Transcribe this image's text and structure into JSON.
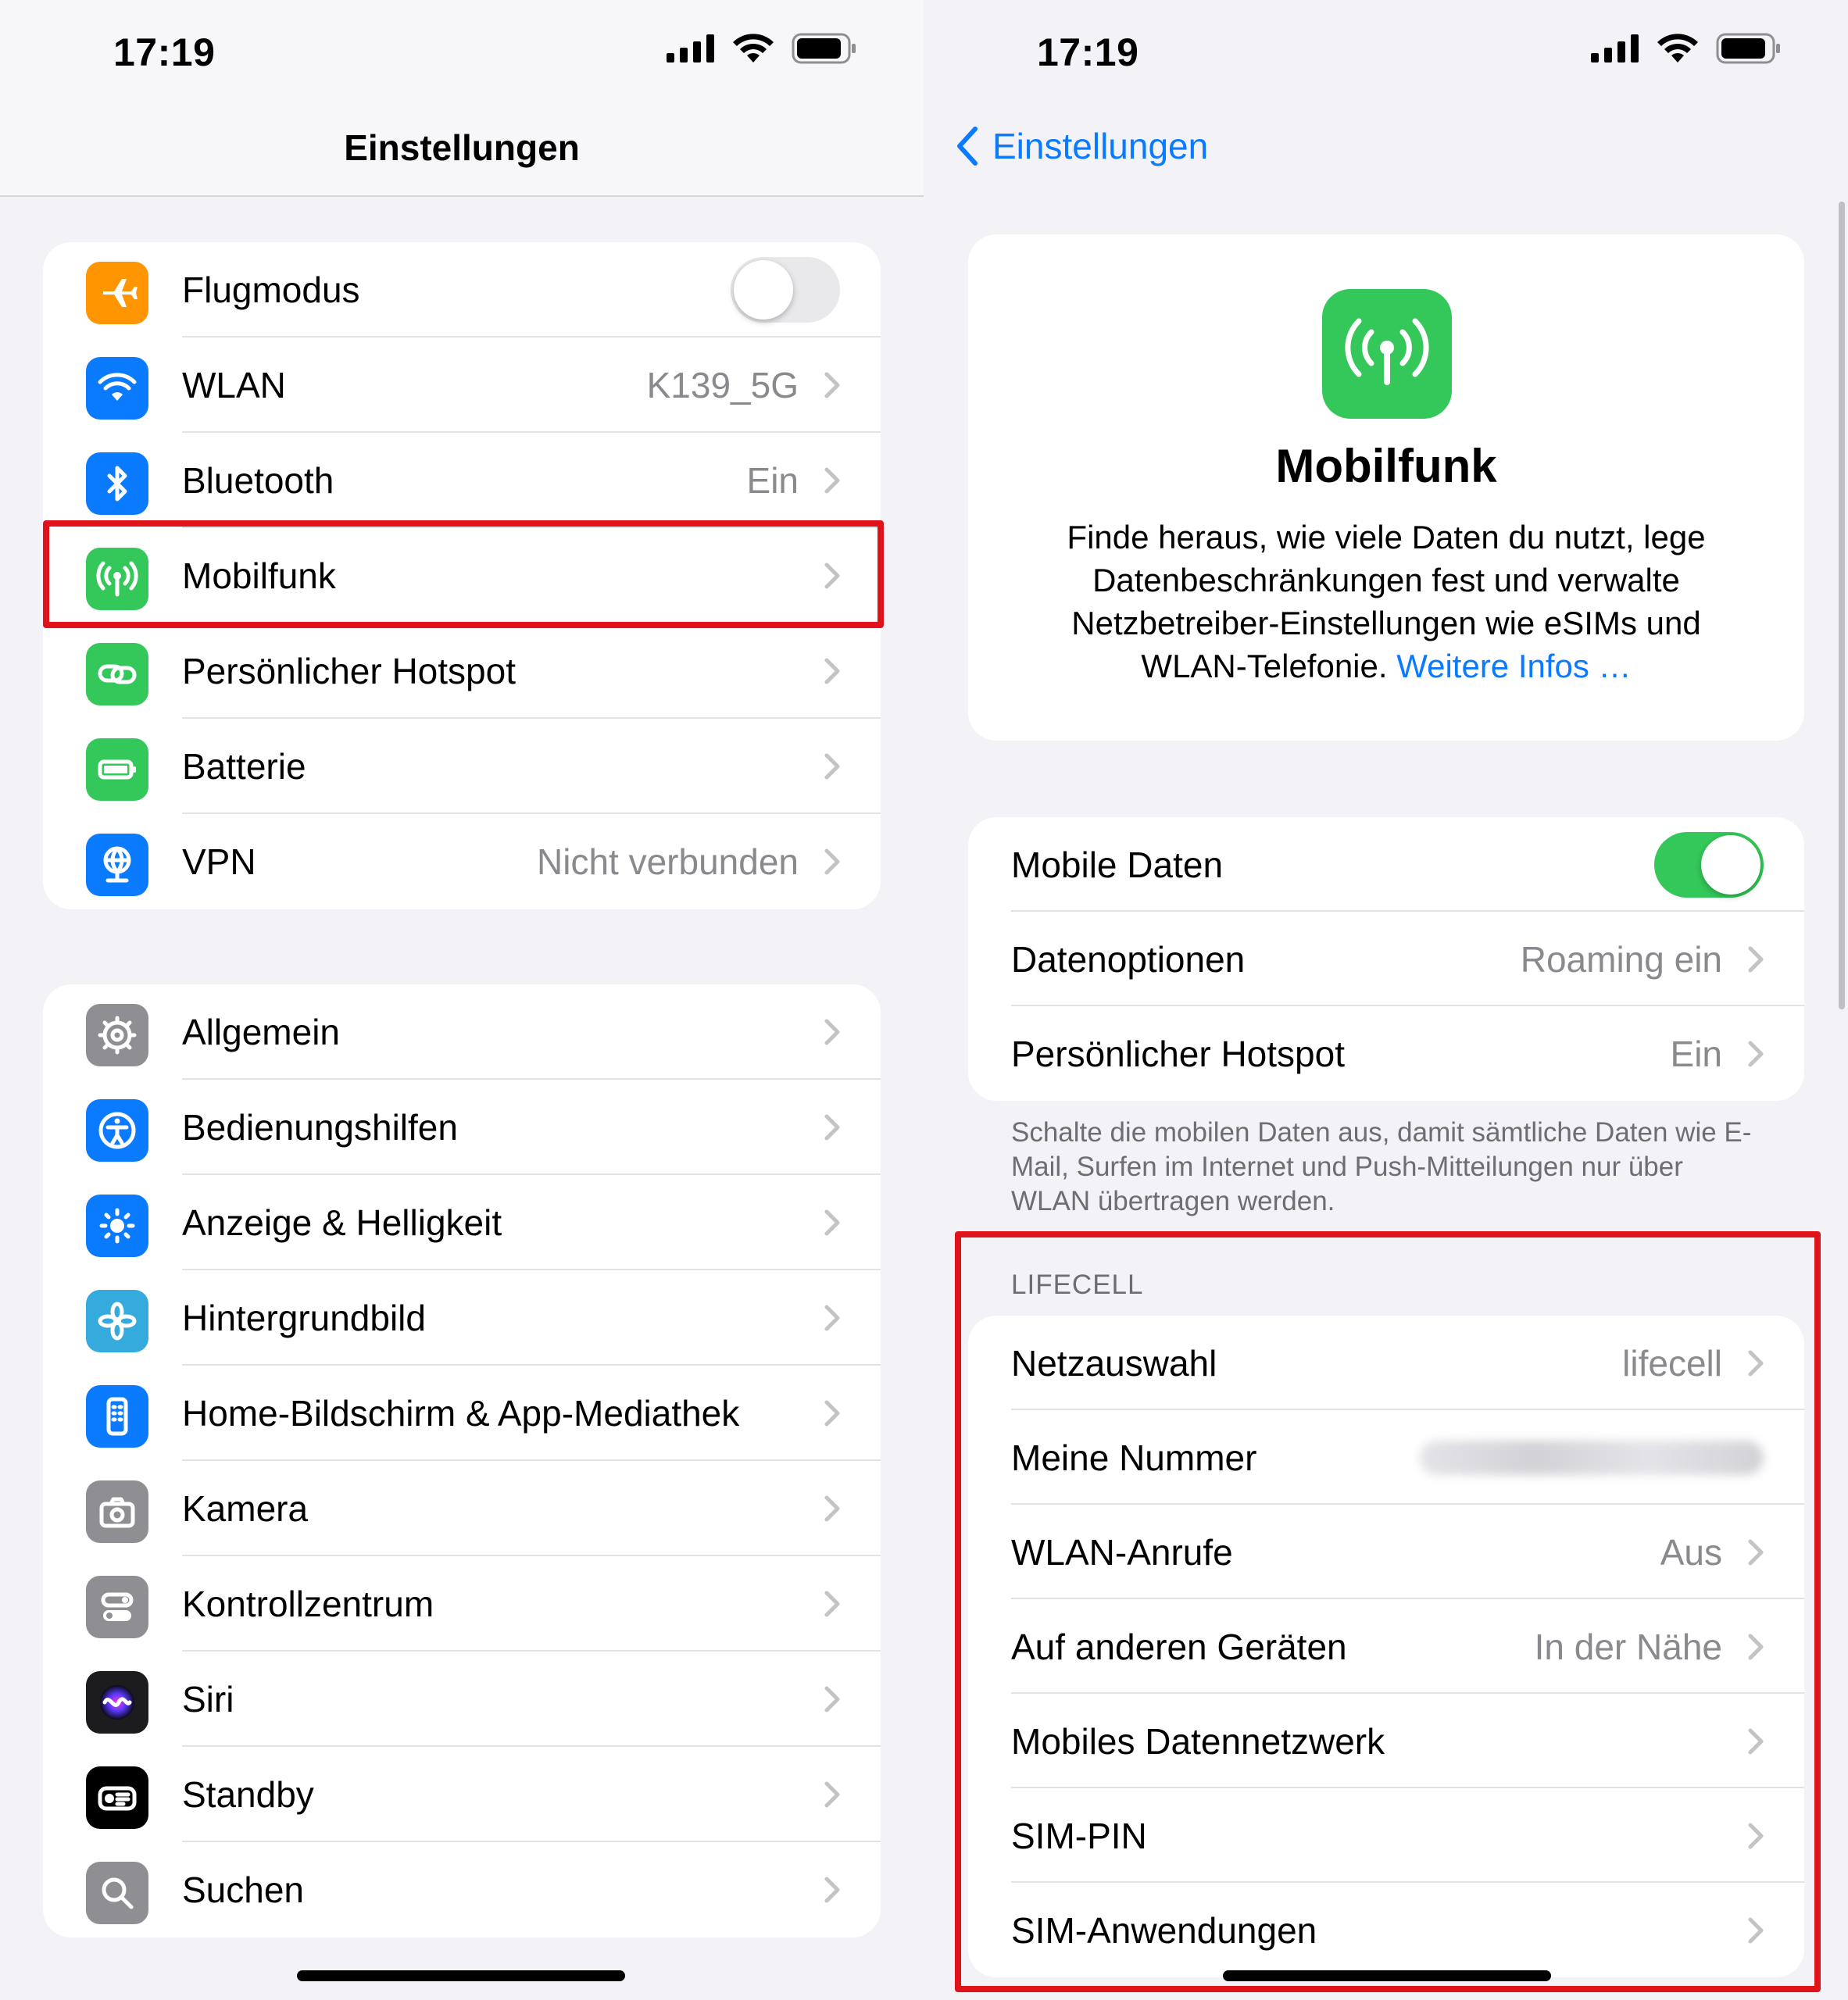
{
  "status": {
    "time": "17:19"
  },
  "left": {
    "nav_title": "Einstellungen",
    "group1": [
      {
        "label": "Flugmodus",
        "icon": "airplane-icon",
        "color": "#ff9500",
        "toggle": false
      },
      {
        "label": "WLAN",
        "icon": "wifi-icon",
        "color": "#0a7aff",
        "value": "K139_5G"
      },
      {
        "label": "Bluetooth",
        "icon": "bluetooth-icon",
        "color": "#0a7aff",
        "value": "Ein"
      },
      {
        "label": "Mobilfunk",
        "icon": "antenna-icon",
        "color": "#34c759",
        "value": ""
      },
      {
        "label": "Persönlicher Hotspot",
        "icon": "hotspot-link-icon",
        "color": "#34c759",
        "value": ""
      },
      {
        "label": "Batterie",
        "icon": "battery-icon",
        "color": "#34c759",
        "value": ""
      },
      {
        "label": "VPN",
        "icon": "vpn-globe-icon",
        "color": "#0a7aff",
        "value": "Nicht verbunden"
      }
    ],
    "group2": [
      {
        "label": "Allgemein",
        "icon": "gear-icon",
        "color": "#8e8e93"
      },
      {
        "label": "Bedienungshilfen",
        "icon": "accessibility-icon",
        "color": "#0a7aff"
      },
      {
        "label": "Anzeige & Helligkeit",
        "icon": "brightness-icon",
        "color": "#0a7aff"
      },
      {
        "label": "Hintergrundbild",
        "icon": "flower-icon",
        "color": "#35aadc"
      },
      {
        "label": "Home-Bildschirm & App-Mediathek",
        "icon": "phone-grid-icon",
        "color": "#0a7aff"
      },
      {
        "label": "Kamera",
        "icon": "camera-icon",
        "color": "#8e8e93"
      },
      {
        "label": "Kontrollzentrum",
        "icon": "switches-icon",
        "color": "#8e8e93"
      },
      {
        "label": "Siri",
        "icon": "siri-icon",
        "color": "#1c1c1e"
      },
      {
        "label": "Standby",
        "icon": "standby-icon",
        "color": "#000000"
      },
      {
        "label": "Suchen",
        "icon": "search-icon",
        "color": "#8e8e93"
      }
    ]
  },
  "right": {
    "back_label": "Einstellungen",
    "header": {
      "title": "Mobilfunk",
      "description": "Finde heraus, wie viele Daten du nutzt, lege Datenbeschränkungen fest und verwalte Netzbetreiber-Einstellungen wie eSIMs und WLAN-Telefonie.",
      "link": "Weitere Infos …"
    },
    "group1": [
      {
        "label": "Mobile Daten",
        "toggle": true
      },
      {
        "label": "Datenoptionen",
        "value": "Roaming ein"
      },
      {
        "label": "Persönlicher Hotspot",
        "value": "Ein"
      }
    ],
    "footer_note": "Schalte die mobilen Daten aus, damit sämtliche Daten wie E-Mail, Surfen im Internet und Push-Mitteilungen nur über WLAN übertragen werden.",
    "section_title": "LIFECELL",
    "group2": [
      {
        "label": "Netzauswahl",
        "value": "lifecell",
        "chevron": true
      },
      {
        "label": "Meine Nummer",
        "value": "",
        "blurred": true,
        "chevron": false
      },
      {
        "label": "WLAN-Anrufe",
        "value": "Aus",
        "chevron": true
      },
      {
        "label": "Auf anderen Geräten",
        "value": "In der Nähe",
        "chevron": true
      },
      {
        "label": "Mobiles Datennetzwerk",
        "value": "",
        "chevron": true
      },
      {
        "label": "SIM-PIN",
        "value": "",
        "chevron": true
      },
      {
        "label": "SIM-Anwendungen",
        "value": "",
        "chevron": true
      }
    ]
  },
  "colors": {
    "accent": "#0a7aff",
    "highlight": "#e0121a",
    "green": "#34c759"
  }
}
